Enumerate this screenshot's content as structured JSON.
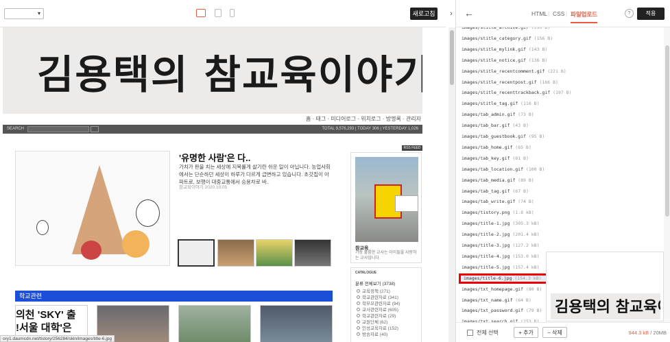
{
  "toolbar": {
    "refresh_label": "새로고침",
    "collapse_icon": "›"
  },
  "preview": {
    "blog_title": "김용택의 참교육이야기",
    "nav_links": "홈 · 태그 · 미디어로그 · 위치로그 · 방명록 · 관리자",
    "search": {
      "label": "SEARCH",
      "go": "GO",
      "stats": "TOTAL 9,576,293 | TODAY 306 | YESTERDAY 1,026"
    },
    "rss_label": "RSS FEED",
    "post": {
      "title": "'유명한 사람'은 다..",
      "body": "가치가 판을 치는 세상에 지목률게 살기란 쉬운 일이 아닙니다. 농업사회에서는 단순하던 세상이 하루가 다르게 급변하고 있습니다. 초갓집이 아파트로, 보행이 대중교통에서 승용차로 바..",
      "meta": "참교육이야기  2020.10.05"
    },
    "profile": {
      "name": "참교육",
      "desc": "가장 훌륭한 교사는 아이들을 사랑하는 교사입니다."
    },
    "catalogue": {
      "heading": "CATALOGUE",
      "all": "분류 전체보기 (3738)",
      "items": [
        "교육정책 (271)",
        "학교관련자료 (341)",
        "학부모관련자료 (94)",
        "교사관련자료 (605)",
        "학교관련자료 (29)",
        "교원단체 (62)",
        "인성교육자료 (152)",
        "방송자료 (40)"
      ]
    },
    "school_section": "학교관련",
    "school_thumb_text": [
      "의천 'SKY' 출",
      "!서울 대학'은 "
    ],
    "status_url": "ory1.daumcdn.net/tistory/256284/skin/images/title-6.jpg"
  },
  "panel": {
    "tabs": [
      "HTML",
      "CSS",
      "파일업로드"
    ],
    "active_tab": "파일업로드",
    "help_label": "?",
    "apply_label": "적용",
    "files": [
      {
        "name": "images/stitle_archive.gif",
        "size": "(190 B)"
      },
      {
        "name": "images/stitle_category.gif",
        "size": "(156 B)"
      },
      {
        "name": "images/stitle_mylink.gif",
        "size": "(143 B)"
      },
      {
        "name": "images/stitle_notice.gif",
        "size": "(136 B)"
      },
      {
        "name": "images/stitle_recentcomment.gif",
        "size": "(221 B)"
      },
      {
        "name": "images/stitle_recentpost.gif",
        "size": "(166 B)"
      },
      {
        "name": "images/stitle_recenttrackback.gif",
        "size": "(197 B)"
      },
      {
        "name": "images/stitle_tag.gif",
        "size": "(116 B)"
      },
      {
        "name": "images/tab_admin.gif",
        "size": "(73 B)"
      },
      {
        "name": "images/tab_bar.gif",
        "size": "(43 B)"
      },
      {
        "name": "images/tab_guestbook.gif",
        "size": "(95 B)"
      },
      {
        "name": "images/tab_home.gif",
        "size": "(65 B)"
      },
      {
        "name": "images/tab_key.gif",
        "size": "(81 B)"
      },
      {
        "name": "images/tab_location.gif",
        "size": "(100 B)"
      },
      {
        "name": "images/tab_media.gif",
        "size": "(89 B)"
      },
      {
        "name": "images/tab_tag.gif",
        "size": "(67 B)"
      },
      {
        "name": "images/tab_write.gif",
        "size": "(74 B)"
      },
      {
        "name": "images/tistory.png",
        "size": "(1.8 kB)"
      },
      {
        "name": "images/title-1.jpg",
        "size": "(305.3 kB)"
      },
      {
        "name": "images/title-2.jpg",
        "size": "(201.4 kB)"
      },
      {
        "name": "images/title-3.jpg",
        "size": "(127.2 kB)"
      },
      {
        "name": "images/title-4.jpg",
        "size": "(153.0 kB)"
      },
      {
        "name": "images/title-5.jpg",
        "size": "(157.4 kB)"
      },
      {
        "name": "images/title-6.jpg",
        "size": "(154.3 kB)",
        "selected": true
      },
      {
        "name": "images/txt_homepage.gif",
        "size": "(80 B)"
      },
      {
        "name": "images/txt_name.gif",
        "size": "(64 B)"
      },
      {
        "name": "images/txt_password.gif",
        "size": "(79 B)"
      },
      {
        "name": "images/txt_search.gif",
        "size": "(153 B)"
      }
    ],
    "preview_title": "김용택의 참교육이야기",
    "footer": {
      "select_all": "전체 선택",
      "add": "+ 추가",
      "delete": "− 삭제",
      "usage_used": "944.3 kB",
      "usage_total": " / 20MB"
    }
  },
  "colors": {
    "accent": "#e95b3c",
    "school_bar": "#1c4fd8",
    "highlight_box": "#ee0000"
  }
}
